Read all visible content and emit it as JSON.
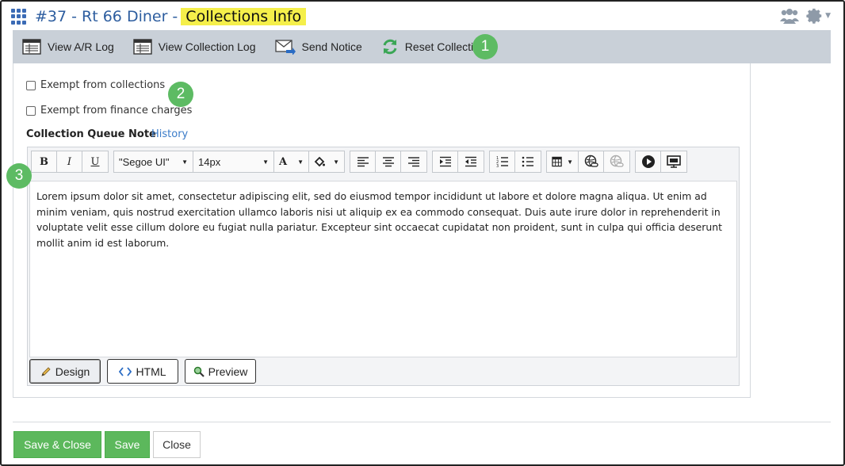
{
  "header": {
    "title_prefix": "#37 - Rt 66 Diner -",
    "title_highlight": "Collections Info",
    "icons": [
      "apps-grid-icon",
      "users-icon",
      "gear-icon"
    ]
  },
  "toolbar": {
    "view_ar_log": "View A/R Log",
    "view_collection_log": "View Collection Log",
    "send_notice": "Send Notice",
    "reset_collections": "Reset Collections"
  },
  "callouts": {
    "one": "1",
    "two": "2",
    "three": "3"
  },
  "options": {
    "exempt_collections": "Exempt from collections",
    "exempt_finance": "Exempt from finance charges"
  },
  "note": {
    "label": "Collection Queue Note",
    "history_link": "History"
  },
  "editor": {
    "font_family": "\"Segoe UI\"",
    "font_size": "14px",
    "bold": "B",
    "italic": "I",
    "underline": "U",
    "font_color": "A",
    "content": "Lorem ipsum dolor sit amet, consectetur adipiscing elit, sed do eiusmod tempor incididunt ut labore et dolore magna aliqua. Ut enim ad minim veniam, quis nostrud exercitation ullamco laboris nisi ut aliquip ex ea commodo consequat. Duis aute irure dolor in reprehenderit in voluptate velit esse cillum dolore eu fugiat nulla pariatur. Excepteur sint occaecat cupidatat non proident, sunt in culpa qui officia deserunt mollit anim id est laborum.",
    "modes": {
      "design": "Design",
      "html": "HTML",
      "preview": "Preview"
    }
  },
  "footer": {
    "save_close": "Save & Close",
    "save": "Save",
    "close": "Close"
  },
  "colors": {
    "accent_blue": "#2d5d9f",
    "highlight": "#f5ef4a",
    "callout_green": "#5dbb63",
    "toolbar_bg": "#c9d0d8",
    "button_green": "#5cb85c"
  }
}
